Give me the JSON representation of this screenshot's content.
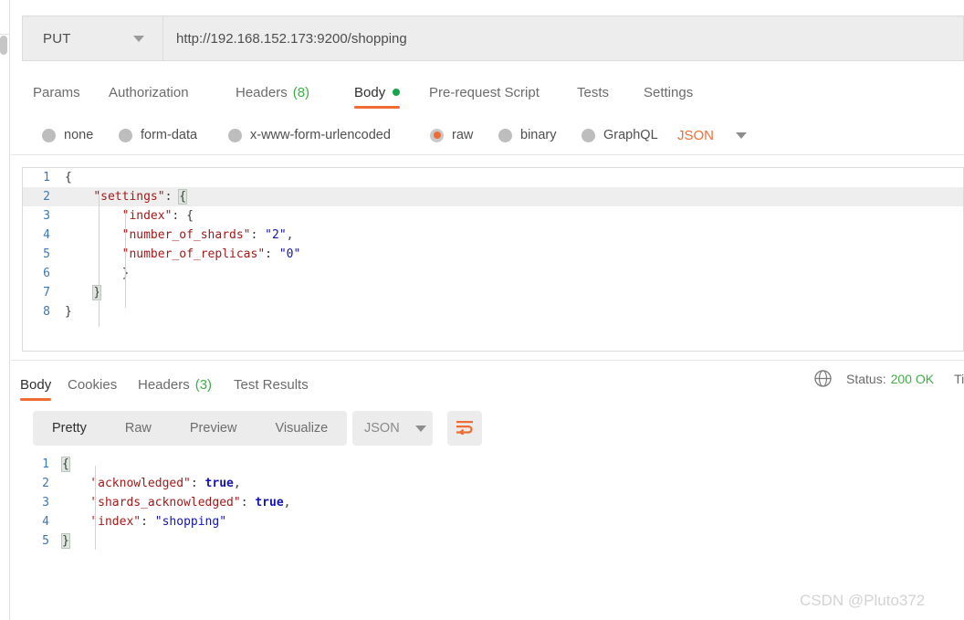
{
  "request": {
    "method": "PUT",
    "url": "http://192.168.152.173:9200/shopping",
    "tabs": [
      {
        "label": "Params",
        "active": false,
        "badge": "",
        "dot": false
      },
      {
        "label": "Authorization",
        "active": false,
        "badge": "",
        "dot": false
      },
      {
        "label": "Headers",
        "active": false,
        "badge": "(8)",
        "dot": false
      },
      {
        "label": "Body",
        "active": true,
        "badge": "",
        "dot": true
      },
      {
        "label": "Pre-request Script",
        "active": false,
        "badge": "",
        "dot": false
      },
      {
        "label": "Tests",
        "active": false,
        "badge": "",
        "dot": false
      },
      {
        "label": "Settings",
        "active": false,
        "badge": "",
        "dot": false
      }
    ],
    "body_modes": [
      {
        "label": "none",
        "selected": false
      },
      {
        "label": "form-data",
        "selected": false
      },
      {
        "label": "x-www-form-urlencoded",
        "selected": false
      },
      {
        "label": "raw",
        "selected": true
      },
      {
        "label": "binary",
        "selected": false
      },
      {
        "label": "GraphQL",
        "selected": false
      }
    ],
    "raw_type": "JSON",
    "body_lines": [
      {
        "n": "1",
        "text": "{"
      },
      {
        "n": "2",
        "text": "    \"settings\": {"
      },
      {
        "n": "3",
        "text": "        \"index\": {"
      },
      {
        "n": "4",
        "text": "        \"number_of_shards\": \"2\","
      },
      {
        "n": "5",
        "text": "        \"number_of_replicas\": \"0\""
      },
      {
        "n": "6",
        "text": "        }"
      },
      {
        "n": "7",
        "text": "    }"
      },
      {
        "n": "8",
        "text": "}"
      }
    ]
  },
  "response": {
    "tabs": [
      {
        "label": "Body",
        "active": true,
        "badge": ""
      },
      {
        "label": "Cookies",
        "active": false,
        "badge": ""
      },
      {
        "label": "Headers",
        "active": false,
        "badge": "(3)"
      },
      {
        "label": "Test Results",
        "active": false,
        "badge": ""
      }
    ],
    "status_label": "Status:",
    "status_value": "200 OK",
    "time_label": "Ti",
    "view_buttons": [
      {
        "label": "Pretty",
        "active": true
      },
      {
        "label": "Raw",
        "active": false
      },
      {
        "label": "Preview",
        "active": false
      },
      {
        "label": "Visualize",
        "active": false
      }
    ],
    "format": "JSON",
    "body_lines": [
      {
        "n": "1",
        "text": "{"
      },
      {
        "n": "2",
        "text": "    \"acknowledged\": true,"
      },
      {
        "n": "3",
        "text": "    \"shards_acknowledged\": true,"
      },
      {
        "n": "4",
        "text": "    \"index\": \"shopping\""
      },
      {
        "n": "5",
        "text": "}"
      }
    ]
  },
  "watermark": "CSDN @Pluto372",
  "colors": {
    "accent": "#ef6c35",
    "success": "#3fae46",
    "key": "#a31919",
    "string": "#1414b4",
    "linenum": "#3c78b4"
  }
}
